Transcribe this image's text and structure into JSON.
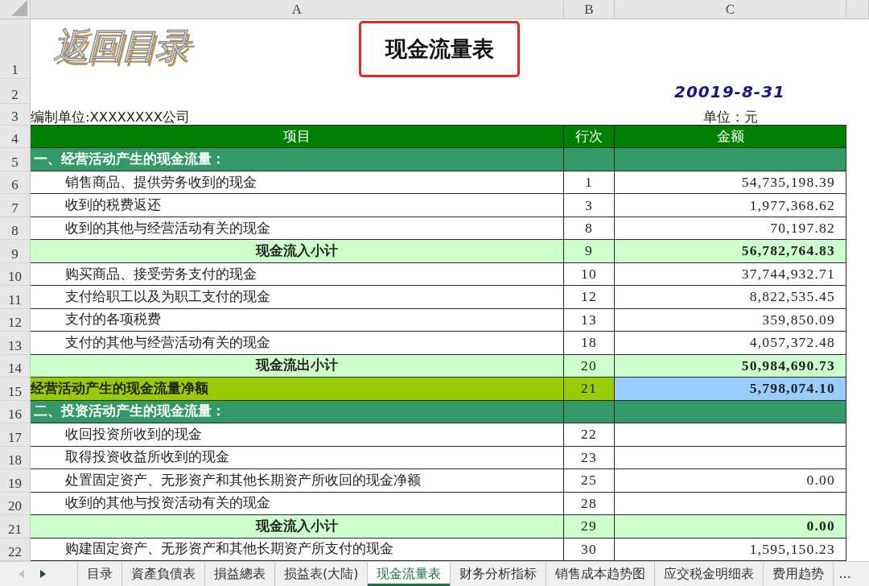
{
  "sheet": {
    "column_headers": [
      "A",
      "B",
      "C"
    ],
    "rows": [
      {
        "kind": "title",
        "row_number": "1",
        "return_link": "返回目录",
        "title": "现金流量表"
      },
      {
        "kind": "date",
        "row_number": "2",
        "date": "20019-8-31"
      },
      {
        "kind": "info",
        "row_number": "3",
        "company": "编制单位:XXXXXXXX公司",
        "unit": "单位：元"
      },
      {
        "kind": "header",
        "row_number": "4",
        "item": "项目",
        "line": "行次",
        "amount": "金额"
      },
      {
        "kind": "section",
        "row_number": "5",
        "item": "一、经营活动产生的现金流量："
      },
      {
        "kind": "line",
        "row_number": "6",
        "item": "销售商品、提供劳务收到的现金",
        "line": "1",
        "amount": "54,735,198.39"
      },
      {
        "kind": "line",
        "row_number": "7",
        "item": "收到的税费返还",
        "line": "3",
        "amount": "1,977,368.62"
      },
      {
        "kind": "line",
        "row_number": "8",
        "item": "收到的其他与经营活动有关的现金",
        "line": "8",
        "amount": "70,197.82"
      },
      {
        "kind": "subtotal",
        "row_number": "9",
        "item": "现金流入小计",
        "line": "9",
        "amount": "56,782,764.83"
      },
      {
        "kind": "line",
        "row_number": "10",
        "item": "购买商品、接受劳务支付的现金",
        "line": "10",
        "amount": "37,744,932.71"
      },
      {
        "kind": "line",
        "row_number": "11",
        "item": "支付给职工以及为职工支付的现金",
        "line": "12",
        "amount": "8,822,535.45"
      },
      {
        "kind": "line",
        "row_number": "12",
        "item": "支付的各项税费",
        "line": "13",
        "amount": "359,850.09"
      },
      {
        "kind": "line",
        "row_number": "13",
        "item": "支付的其他与经营活动有关的现金",
        "line": "18",
        "amount": "4,057,372.48"
      },
      {
        "kind": "subtotal",
        "row_number": "14",
        "item": "现金流出小计",
        "line": "20",
        "amount": "50,984,690.73"
      },
      {
        "kind": "net",
        "row_number": "15",
        "item": "经营活动产生的现金流量净额",
        "line": "21",
        "amount": "5,798,074.10"
      },
      {
        "kind": "section",
        "row_number": "16",
        "item": "二、投资活动产生的现金流量："
      },
      {
        "kind": "line",
        "row_number": "17",
        "item": "收回投资所收到的现金",
        "line": "22"
      },
      {
        "kind": "line",
        "row_number": "18",
        "item": "取得投资收益所收到的现金",
        "line": "23"
      },
      {
        "kind": "line",
        "row_number": "19",
        "item": "处置固定资产、无形资产和其他长期资产所收回的现金净额",
        "line": "25",
        "amount": "0.00"
      },
      {
        "kind": "line",
        "row_number": "20",
        "item": "收到的其他与投资活动有关的现金",
        "line": "28"
      },
      {
        "kind": "subtotal",
        "row_number": "21",
        "item": "现金流入小计",
        "line": "29",
        "amount": "0.00"
      },
      {
        "kind": "line",
        "row_number": "22",
        "item": "购建固定资产、无形资产和其他长期资产所支付的现金",
        "line": "30",
        "amount": "1,595,150.23"
      }
    ]
  },
  "tab_bar": {
    "nav": [
      {
        "kind": "left",
        "disabled": true
      },
      {
        "kind": "right",
        "disabled": false
      }
    ],
    "tabs": [
      {
        "label": "目录",
        "selected": false
      },
      {
        "label": "資產負債表",
        "selected": false
      },
      {
        "label": "損益總表",
        "selected": false
      },
      {
        "label": "损益表(大陆)",
        "selected": false
      },
      {
        "label": "现金流量表",
        "selected": true
      },
      {
        "label": "财务分析指标",
        "selected": false
      },
      {
        "label": "销售成本趋势图",
        "selected": false
      },
      {
        "label": "应交税金明细表",
        "selected": false
      },
      {
        "label": "费用趋势",
        "selected": false
      }
    ],
    "more": "..."
  }
}
